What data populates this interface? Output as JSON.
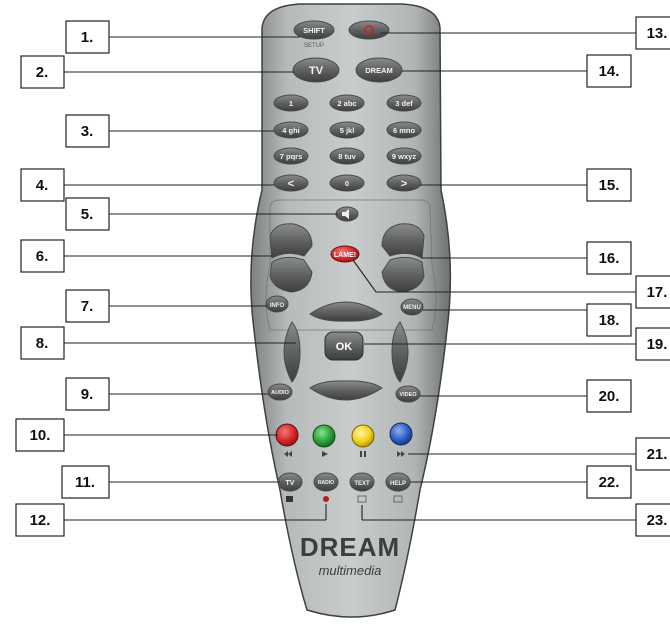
{
  "callouts": {
    "c1": "1.",
    "c2": "2.",
    "c3": "3.",
    "c4": "4.",
    "c5": "5.",
    "c6": "6.",
    "c7": "7.",
    "c8": "8.",
    "c9": "9.",
    "c10": "10.",
    "c11": "11.",
    "c12": "12.",
    "c13": "13.",
    "c14": "14.",
    "c15": "15.",
    "c16": "16.",
    "c17": "17.",
    "c18": "18.",
    "c19": "19.",
    "c20": "20.",
    "c21": "21.",
    "c22": "22.",
    "c23": "23."
  },
  "remote": {
    "shift": "SHIFT",
    "setup": "SETUP",
    "tv_mode": "TV",
    "dream_mode": "DREAM",
    "numbers": [
      "1",
      "2 abc",
      "3 def",
      "4 ghi",
      "5 jkl",
      "6 mno",
      "7 pqrs",
      "8 tuv",
      "9 wxyz",
      "0"
    ],
    "left_arrow": "<",
    "right_arrow": ">",
    "lame": "LAME!",
    "info": "INFO",
    "menu": "MENU",
    "ok": "OK",
    "audio": "AUDIO",
    "video": "VIDEO",
    "tv": "TV",
    "radio": "RADIO",
    "text": "TEXT",
    "help": "HELP",
    "logo_main": "DREAM",
    "logo_sub": "multimedia"
  },
  "colors": {
    "red": "#d8262a",
    "green": "#2aa13a",
    "yellow": "#f2d21a",
    "blue": "#2f5fc4",
    "power": "#d02020",
    "body": "#a9acad"
  }
}
